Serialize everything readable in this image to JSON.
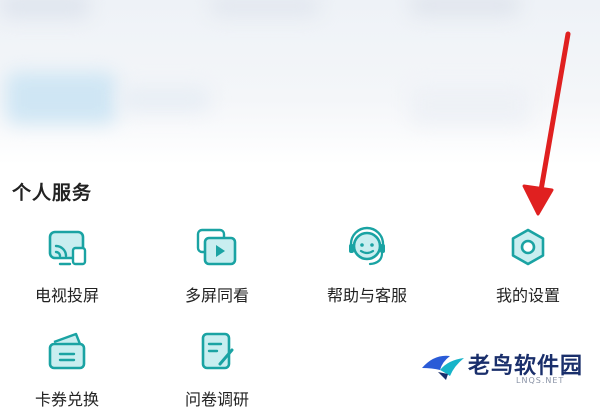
{
  "section": {
    "title": "个人服务"
  },
  "services": [
    {
      "label": "电视投屏",
      "icon": "tv-cast-icon"
    },
    {
      "label": "多屏同看",
      "icon": "multi-screen-icon"
    },
    {
      "label": "帮助与客服",
      "icon": "customer-service-icon"
    },
    {
      "label": "我的设置",
      "icon": "settings-hexagon-icon"
    },
    {
      "label": "卡券兑换",
      "icon": "wallet-coupon-icon"
    },
    {
      "label": "问卷调研",
      "icon": "survey-edit-icon"
    }
  ],
  "watermark": {
    "text": "老鸟软件园",
    "sub": "LNQS.NET"
  },
  "colors": {
    "icon_teal": "#1aa3a3",
    "icon_fill": "#c9eef0",
    "arrow_red": "#e02020"
  }
}
